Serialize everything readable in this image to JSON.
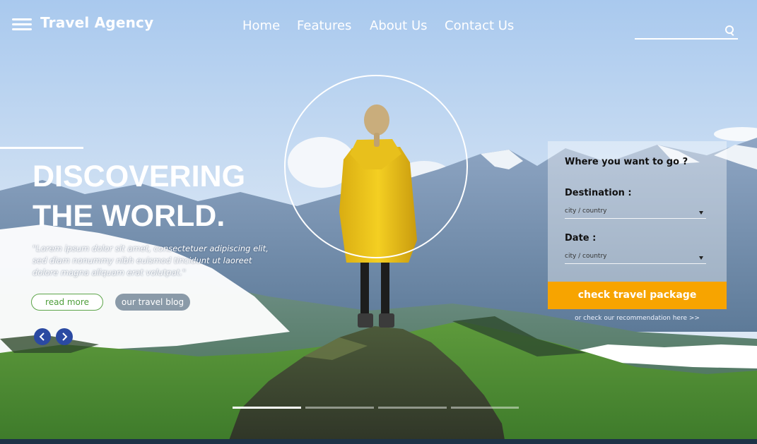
{
  "brand": {
    "name": "Travel Agency",
    "icon": "hamburger-menu-icon"
  },
  "nav": [
    "Home",
    "Features",
    "About Us",
    "Contact Us"
  ],
  "search": {
    "value": "",
    "placeholder": "",
    "icon": "search-icon"
  },
  "hero": {
    "title_line1": "DISCOVERING",
    "title_line2": "THE WORLD.",
    "description": "\"Lorem ipsum dolor sit amet, consectetuer adipiscing elit, sed diam nonummy nibh euismod tincidunt ut laoreet dolore magna aliquam erat volutpat.\"",
    "read_more": "read more",
    "blog": "our travel blog"
  },
  "form": {
    "question": "Where you want to go ?",
    "destination_label": "Destination :",
    "destination_value": "city / country",
    "date_label": "Date :",
    "date_value": "city / country",
    "cta": "check travel package",
    "recommendation": "or check our recommendation here >>"
  },
  "slider": {
    "count": 4,
    "active_index": 0
  },
  "colors": {
    "accent": "#f7a400",
    "nav_arrows": "#2b4aa2",
    "read_more_text": "#4e9e3a"
  }
}
